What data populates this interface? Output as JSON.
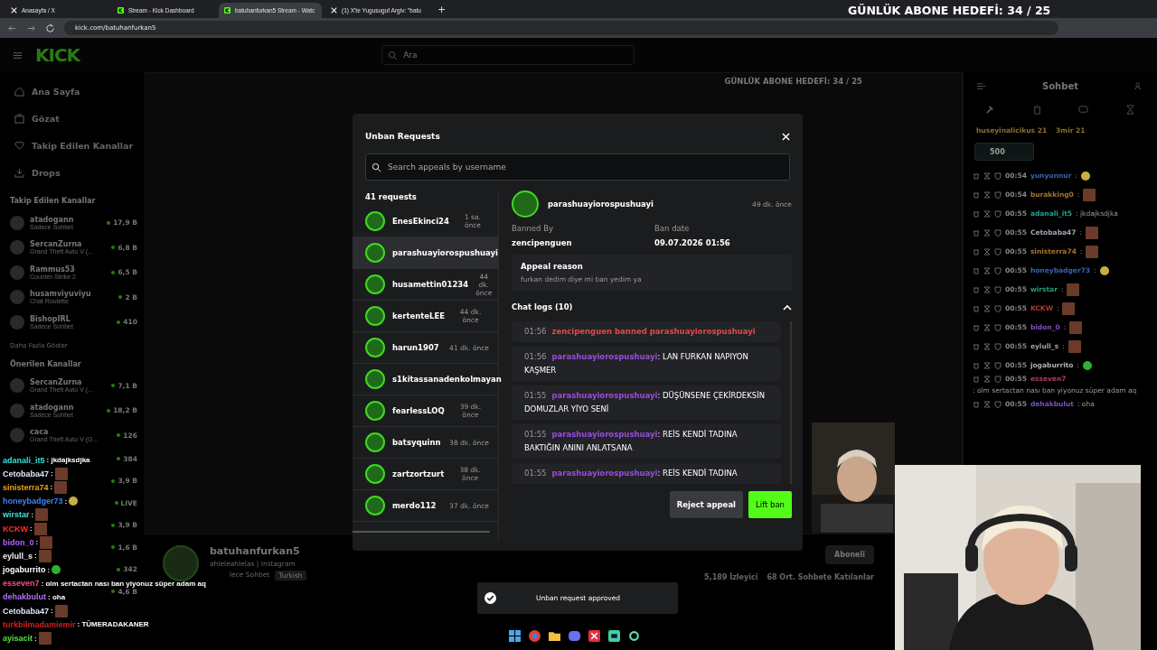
{
  "browser": {
    "tabs": [
      {
        "title": "Anasayfa / X",
        "kind": "x",
        "selected": false
      },
      {
        "title": "Stream - Kick Dashboard",
        "kind": "kick",
        "selected": false
      },
      {
        "title": "batuhanfurkan5 Stream - Watc",
        "kind": "kick",
        "selected": true
      },
      {
        "title": "(1) X'te Yugusuguf Argiv: \"batu",
        "kind": "x",
        "selected": false
      }
    ],
    "new_tab": "+",
    "url": "kick.com/batuhanfurkan5"
  },
  "stream_goal": "GÜNLÜK ABONE HEDEFİ: 34 / 25",
  "header": {
    "logo": "KICK",
    "search_placeholder": "Ara"
  },
  "sidebar": {
    "nav": [
      {
        "label": "Ana Sayfa",
        "kind": "home"
      },
      {
        "label": "Gözat",
        "kind": "browse"
      },
      {
        "label": "Takip Edilen Kanallar",
        "kind": "heart"
      },
      {
        "label": "Drops",
        "kind": "drops"
      }
    ],
    "followed_title": "Takip Edilen Kanallar",
    "followed": [
      {
        "name": "atadogann",
        "sub": "Sadece Sohbet",
        "count": "17,9 B"
      },
      {
        "name": "SercanZurna",
        "sub": "Grand Theft Auto V (...",
        "count": "6,8 B"
      },
      {
        "name": "Rammus53",
        "sub": "Counter-Strike 2",
        "count": "6,5 B"
      },
      {
        "name": "husamviyuviyu",
        "sub": "Chat Roulette",
        "count": "2 B"
      },
      {
        "name": "BishopIRL",
        "sub": "Sadece Sohbet",
        "count": "410"
      }
    ],
    "more": "Daha Fazla Göster",
    "recommended_title": "Önerilen Kanallar",
    "recommended": [
      {
        "name": "SercanZurna",
        "sub": "Grand Theft Auto V (...",
        "count": "7,1 B"
      },
      {
        "name": "atadogann",
        "sub": "Sadece Sohbet",
        "count": "18,2 B"
      },
      {
        "name": "caca",
        "sub": "Grand Theft Auto V (G...",
        "count": "126"
      },
      {
        "count": "384"
      },
      {
        "count": "3,9 B"
      },
      {
        "count": "LIVE"
      },
      {
        "count": "3,9 B"
      },
      {
        "count": "1,6 B"
      },
      {
        "count": "342"
      },
      {
        "count": "4,6 B"
      }
    ]
  },
  "stream": {
    "nested_goal": "GÜNLÜK ABONE HEDEFİ: 34 / 25",
    "channel": "batuhanfurkan5",
    "bio": "ahleleahlelas | Instagram",
    "category": "lece Sohbet",
    "language": "Turkish",
    "subscribe": "Aboneli",
    "viewers": "5,189 İzleyici",
    "chatters": "68 Ort. Sohbete Katılanlar"
  },
  "modal": {
    "title": "Unban Requests",
    "search_placeholder": "Search appeals by username",
    "count": "41 requests",
    "requests": [
      {
        "name": "EnesEkinci24",
        "time": "1 sa. önce",
        "selected": false
      },
      {
        "name": "parashuayiorospushuayi",
        "selected": true
      },
      {
        "name": "husamettin01234",
        "time": "44 dk. önce",
        "selected": false
      },
      {
        "name": "kertenteLEE",
        "time": "44 dk. önce",
        "selected": false
      },
      {
        "name": "harun1907",
        "time": "41 dk. önce",
        "selected": false
      },
      {
        "name": "s1kitassanadenkolmayan",
        "selected": false
      },
      {
        "name": "fearlessLOQ",
        "time": "39 dk. önce",
        "selected": false
      },
      {
        "name": "batsyquinn",
        "time": "38 dk. önce",
        "selected": false
      },
      {
        "name": "zartzortzurt",
        "time": "38 dk. önce",
        "selected": false
      },
      {
        "name": "merdo112",
        "time": "37 dk. önce",
        "selected": false
      }
    ],
    "detail": {
      "name": "parashuayiorospushuayi",
      "time": "49 dk. önce",
      "banned_by_label": "Banned By",
      "banned_by": "zencipenguen",
      "ban_date_label": "Ban date",
      "ban_date": "09.07.2026 01:56",
      "reason_label": "Appeal reason",
      "reason": "furkan dedim diye mi ban yedim ya",
      "logs_title": "Chat logs (10)",
      "logs_expanded": true,
      "logs": [
        {
          "kind": "ban",
          "time": "01:56",
          "text": "zencipenguen banned parashuayiorospushuayi"
        },
        {
          "kind": "message",
          "time": "01:56",
          "user": "parashuayiorospushuayi",
          "text": ": LAN FURKAN NAPIYON KAŞMER"
        },
        {
          "kind": "message",
          "time": "01:55",
          "user": "parashuayiorospushuayi",
          "text": ": DÜŞÜNSENE ÇEKİRDEKSİN DOMUZLAR YİYO SENİ"
        },
        {
          "kind": "message",
          "time": "01:55",
          "user": "parashuayiorospushuayi",
          "text": ": REİS KENDİ TADINA BAKTIĞIN ANINI ANLATSANA"
        },
        {
          "kind": "message",
          "time": "01:55",
          "user": "parashuayiorospushuayi",
          "text": ": REİS KENDİ TADINA"
        }
      ]
    },
    "reject": "Reject appeal",
    "lift": "Lift ban"
  },
  "toast": "Unban request approved",
  "chat": {
    "title": "Sohbet",
    "pinned": [
      {
        "name": "huseyinalicikus",
        "count": "21"
      },
      {
        "name": "3mir",
        "count": "21"
      }
    ],
    "goal_badge": "500",
    "messages": [
      {
        "time": "00:54",
        "user": "yunyunnur",
        "color": "#3a62b0",
        "text": ":",
        "kind": "smile"
      },
      {
        "time": "00:54",
        "user": "burakking0",
        "color": "#a8742a",
        "text": ":",
        "kind": "face"
      },
      {
        "time": "00:55",
        "user": "adanali_it5",
        "color": "#24a090",
        "text": ": jkdajksdjka",
        "kind": "text"
      },
      {
        "time": "00:55",
        "user": "Cetobaba47",
        "color": "#a0a6b4",
        "text": ":",
        "kind": "face"
      },
      {
        "time": "00:55",
        "user": "sinisterra74",
        "color": "#a8742a",
        "text": ":",
        "kind": "face"
      },
      {
        "time": "00:55",
        "user": "honeybadger73",
        "color": "#3a62b0",
        "text": ":",
        "kind": "smile"
      },
      {
        "time": "00:55",
        "user": "wirstar",
        "color": "#24a070",
        "text": ":",
        "kind": "face"
      },
      {
        "time": "00:55",
        "user": "KCKW",
        "color": "#b03a2a",
        "text": ":",
        "kind": "face"
      },
      {
        "time": "00:55",
        "user": "bidon_0",
        "color": "#7a50c0",
        "text": ":",
        "kind": "face"
      },
      {
        "time": "00:55",
        "user": "eylull_s",
        "color": "#a0a0a0",
        "text": ":",
        "kind": "face"
      },
      {
        "time": "00:55",
        "user": "jogaburrito",
        "color": "#b0b0b0",
        "text": ":",
        "kind": "laugh"
      },
      {
        "time": "00:55",
        "user": "esseven7",
        "color": "#b03a68",
        "text": ": olm sertactan nası ban yiyonuz süper adam aq",
        "kind": "text"
      },
      {
        "time": "00:55",
        "user": "dehakbulut",
        "color": "#7a50c0",
        "text": ": oha",
        "kind": "text"
      }
    ]
  },
  "overlay_chat": [
    {
      "user": "adanali_it5",
      "color": "#2ee6d6",
      "text": ": jkdajksdjka",
      "kind": "text"
    },
    {
      "user": "Cetobaba47",
      "color": "#dfe6ff",
      "text": ":",
      "kind": "face"
    },
    {
      "user": "sinisterra74",
      "color": "#f0a020",
      "text": ":",
      "kind": "face"
    },
    {
      "user": "honeybadger73",
      "color": "#3b82f6",
      "text": ":",
      "kind": "smile"
    },
    {
      "user": "wirstar",
      "color": "#40e0e0",
      "text": ":",
      "kind": "face"
    },
    {
      "user": "KCKW",
      "color": "#ff3030",
      "text": ":",
      "kind": "face"
    },
    {
      "user": "bidon_0",
      "color": "#b060ff",
      "text": ":",
      "kind": "face"
    },
    {
      "user": "eylull_s",
      "color": "#f0f0f0",
      "text": ":",
      "kind": "face"
    },
    {
      "user": "jogaburrito",
      "color": "#ffffff",
      "text": ":",
      "kind": "laugh"
    },
    {
      "user": "esseven7",
      "color": "#ff4a8a",
      "text": ": olm sertactan nası ban yiyonuz süper adam aq",
      "kind": "text"
    },
    {
      "user": "dehakbulut",
      "color": "#b070ff",
      "text": ": oha",
      "kind": "text"
    },
    {
      "user": "Cetobaba47",
      "color": "#dfe6ff",
      "text": ":",
      "kind": "face"
    },
    {
      "user": "turkbilmadamiemir",
      "color": "#d02020",
      "text": ": TÜMERADAKANER",
      "kind": "text"
    },
    {
      "user": "ayisacit",
      "color": "#60e040",
      "text": ":",
      "kind": "face"
    }
  ]
}
